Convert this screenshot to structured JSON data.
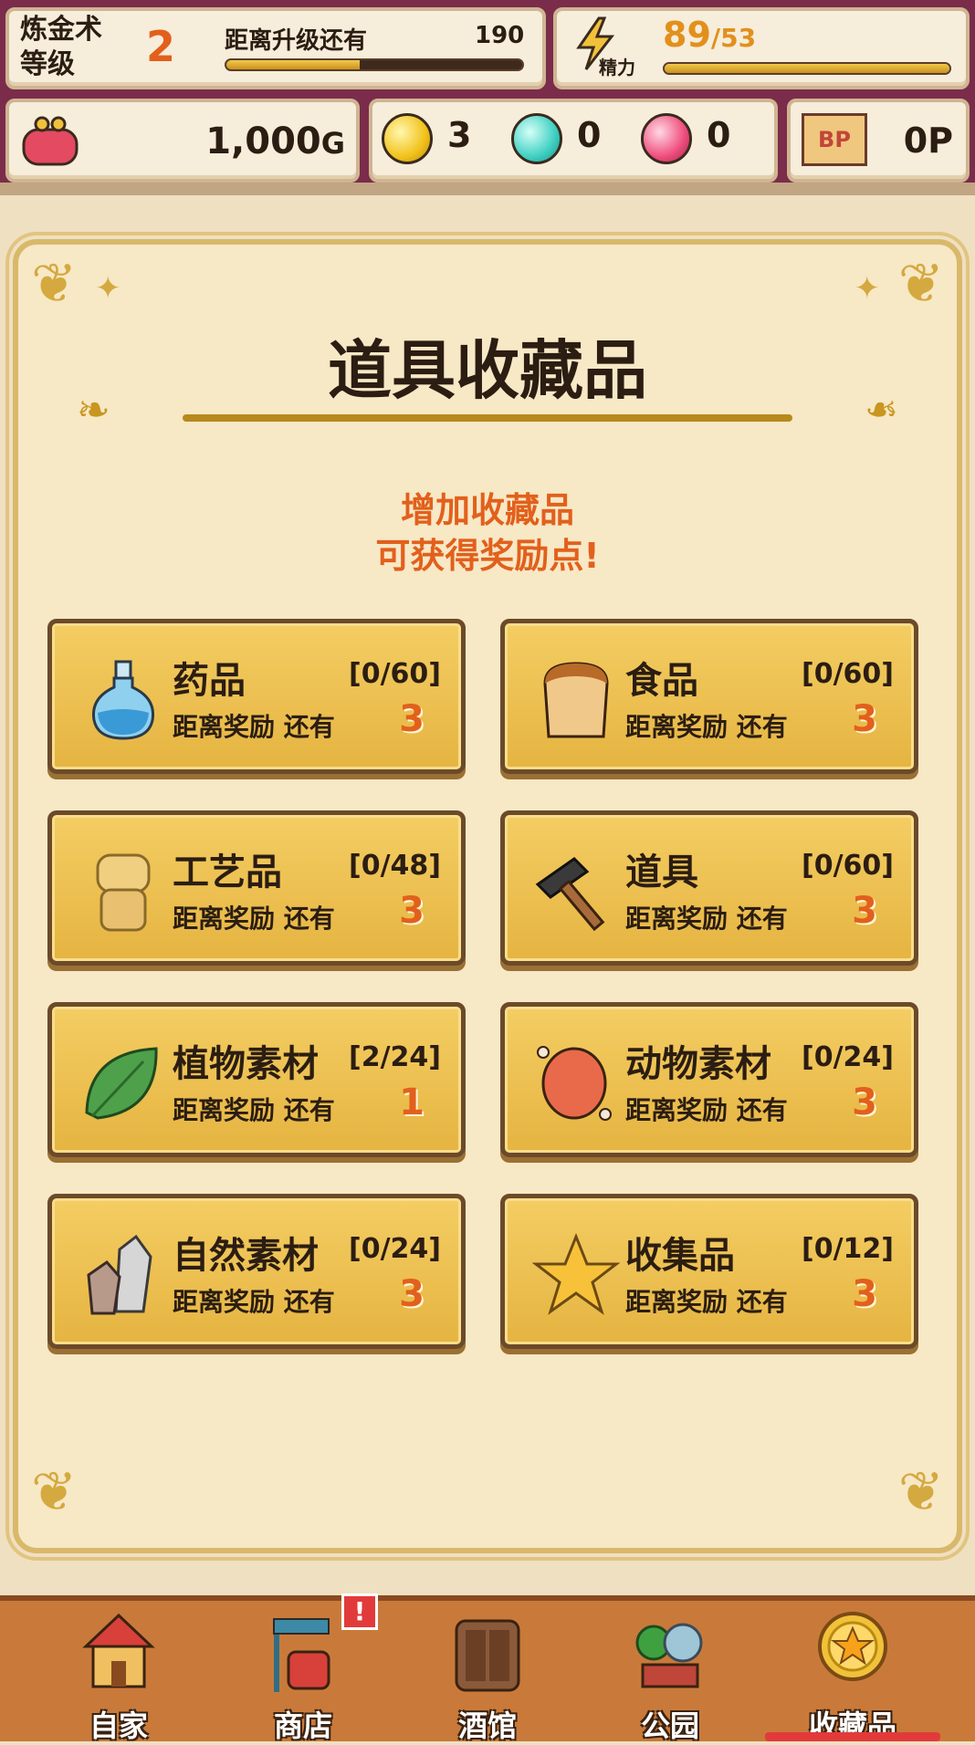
{
  "hud": {
    "alchemy_label_1": "炼金术",
    "alchemy_label_2": "等级",
    "level": "2",
    "next_level_label": "距离升级还有",
    "next_level_value": "190",
    "next_level_progress": 0.45,
    "stamina_value": "89",
    "stamina_max": "/53",
    "stamina_label": "精力",
    "stamina_progress": 1.0,
    "gold": "1,000",
    "gold_unit": "G",
    "gem_yellow": "3",
    "gem_cyan": "0",
    "gem_pink": "0",
    "bp_icon_text": "BP",
    "bp_value": "0P"
  },
  "main": {
    "title": "道具收藏品",
    "hint_line1": "增加收藏品",
    "hint_line2": "可获得奖励点!",
    "categories": [
      {
        "name": "药品",
        "count": "[0/60]",
        "reward_label": "距离奖励 还有",
        "reward_num": "3",
        "icon": "potion-icon"
      },
      {
        "name": "食品",
        "count": "[0/60]",
        "reward_label": "距离奖励 还有",
        "reward_num": "3",
        "icon": "bread-icon"
      },
      {
        "name": "工艺品",
        "count": "[0/48]",
        "reward_label": "距离奖励 还有",
        "reward_num": "3",
        "icon": "figurine-icon"
      },
      {
        "name": "道具",
        "count": "[0/60]",
        "reward_label": "距离奖励 还有",
        "reward_num": "3",
        "icon": "hammer-icon"
      },
      {
        "name": "植物素材",
        "count": "[2/24]",
        "reward_label": "距离奖励 还有",
        "reward_num": "1",
        "icon": "leaf-icon"
      },
      {
        "name": "动物素材",
        "count": "[0/24]",
        "reward_label": "距离奖励 还有",
        "reward_num": "3",
        "icon": "meat-icon"
      },
      {
        "name": "自然素材",
        "count": "[0/24]",
        "reward_label": "距离奖励 还有",
        "reward_num": "3",
        "icon": "stone-icon"
      },
      {
        "name": "收集品",
        "count": "[0/12]",
        "reward_label": "距离奖励 还有",
        "reward_num": "3",
        "icon": "star-icon"
      }
    ]
  },
  "nav": {
    "items": [
      {
        "label": "自家",
        "icon": "house-icon"
      },
      {
        "label": "商店",
        "icon": "shop-icon",
        "alert": "!"
      },
      {
        "label": "酒馆",
        "icon": "tavern-door-icon"
      },
      {
        "label": "公园",
        "icon": "park-icon"
      },
      {
        "label": "收藏品",
        "icon": "collection-medal-icon"
      }
    ]
  },
  "colors": {
    "hud_bg": "#7a2c4a",
    "accent_orange": "#e2601c",
    "card_gold": "#e5b441",
    "nav_bg": "#c97a3a"
  }
}
